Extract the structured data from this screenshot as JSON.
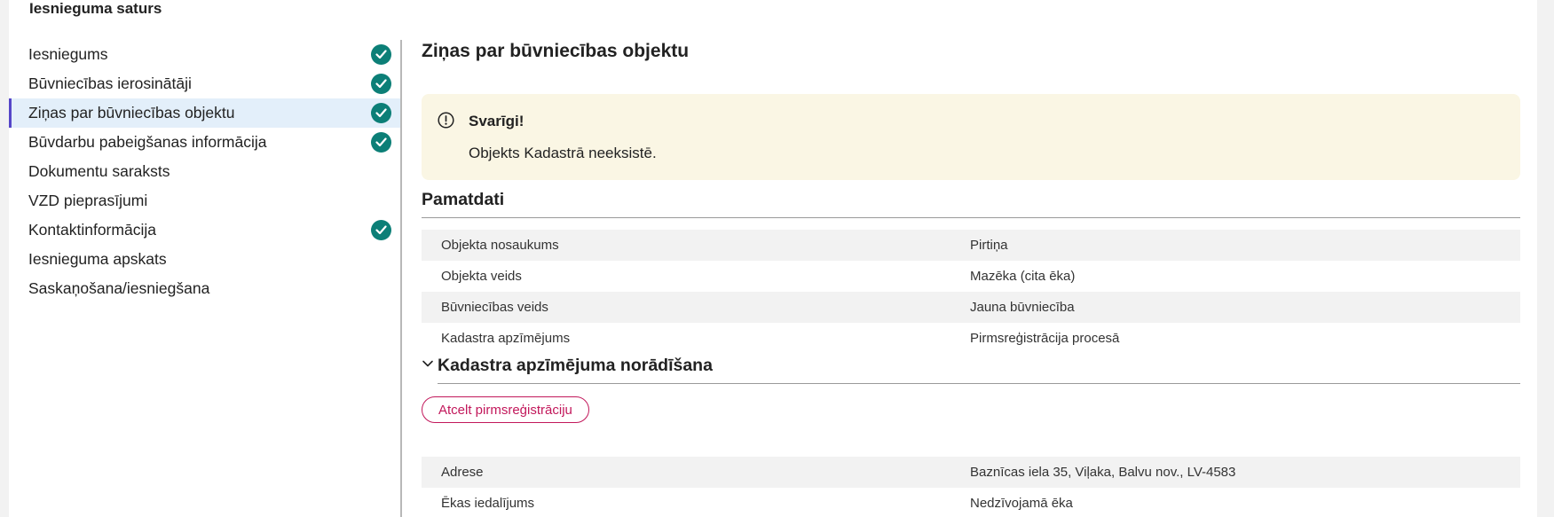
{
  "panel": {
    "title": "Iesnieguma saturs"
  },
  "sidebar": {
    "items": [
      {
        "label": "Iesniegums",
        "completed": true
      },
      {
        "label": "Būvniecības ierosinātāji",
        "completed": true
      },
      {
        "label": "Ziņas par būvniecības objektu",
        "completed": true,
        "active": true
      },
      {
        "label": "Būvdarbu pabeigšanas informācija",
        "completed": true
      },
      {
        "label": "Dokumentu saraksts",
        "completed": false
      },
      {
        "label": "VZD pieprasījumi",
        "completed": false
      },
      {
        "label": "Kontaktinformācija",
        "completed": true
      },
      {
        "label": "Iesnieguma apskats",
        "completed": false
      },
      {
        "label": "Saskaņošana/iesniegšana",
        "completed": false
      }
    ]
  },
  "main": {
    "title": "Ziņas par būvniecības objektu",
    "alert": {
      "icon": "exclamation-circle-icon",
      "title": "Svarīgi!",
      "text": "Objekts Kadastrā neeksistē."
    },
    "basic": {
      "heading": "Pamatdati",
      "rows": [
        {
          "label": "Objekta nosaukums",
          "value": "Pirtiņa"
        },
        {
          "label": "Objekta veids",
          "value": "Mazēka (cita ēka)"
        },
        {
          "label": "Būvniecības veids",
          "value": "Jauna būvniecība"
        },
        {
          "label": "Kadastra apzīmējums",
          "value": "Pirmsreģistrācija procesā"
        }
      ]
    },
    "cadastre": {
      "heading": "Kadastra apzīmējuma norādīšana",
      "button_label": "Atcelt pirmsreģistrāciju",
      "rows": [
        {
          "label": "Adrese",
          "value": "Baznīcas iela 35, Viļaka, Balvu nov., LV-4583"
        },
        {
          "label": "Ēkas iedalījums",
          "value": "Nedzīvojamā ēka"
        }
      ]
    }
  },
  "colors": {
    "check": "#0c7f77",
    "active_bg": "#e3effa",
    "active_bar": "#5546c8",
    "alert_bg": "#faf6e4",
    "button": "#c2185b"
  }
}
